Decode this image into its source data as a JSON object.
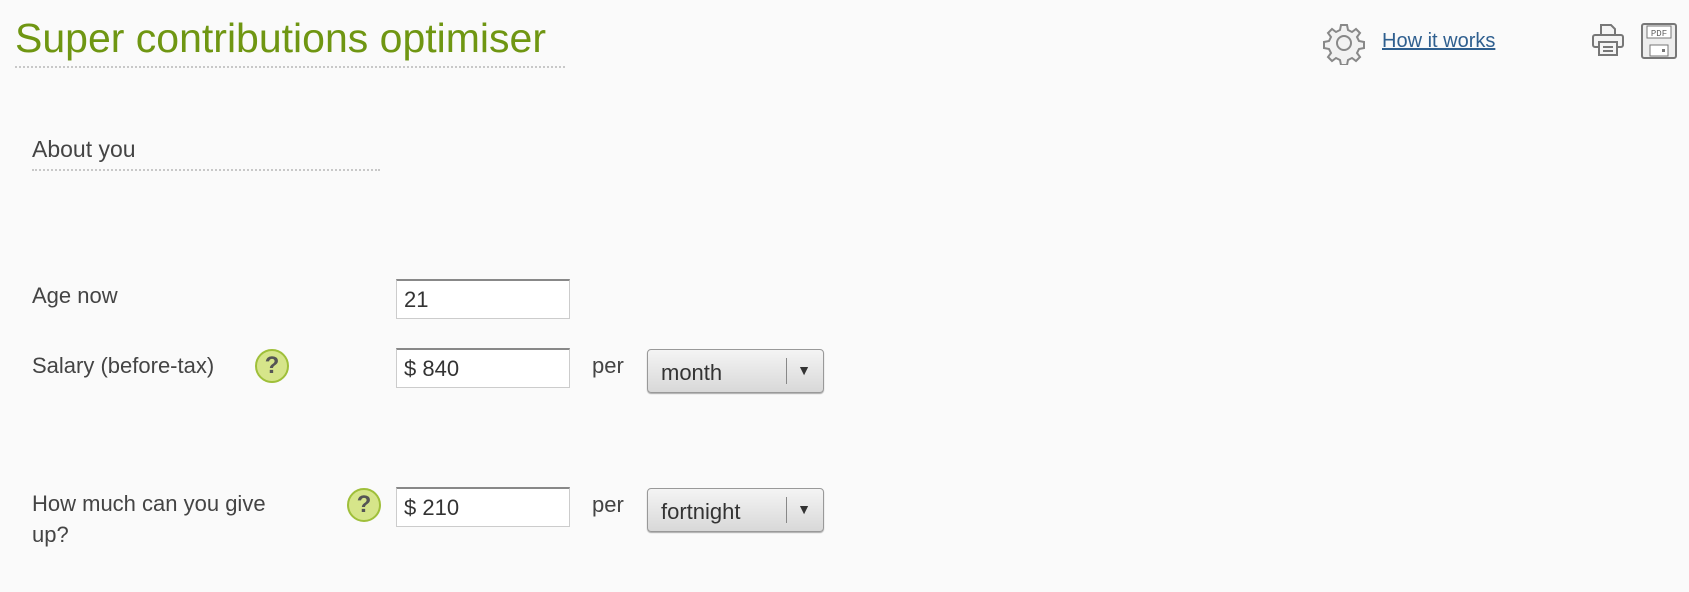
{
  "header": {
    "title": "Super contributions optimiser",
    "how_it_works": "How it works",
    "icons": [
      "gear-icon",
      "print-icon",
      "pdf-save-icon"
    ],
    "pdf_icon_text": "PDF"
  },
  "section": {
    "title": "About you"
  },
  "form": {
    "age": {
      "label": "Age now",
      "value": "21"
    },
    "salary": {
      "label": "Salary (before-tax)",
      "value": "$ 840",
      "per": "per",
      "period": "month",
      "help": "?"
    },
    "give_up": {
      "label": "How much can you give up?",
      "value": "$ 210",
      "per": "per",
      "period": "fortnight",
      "help": "?"
    }
  },
  "colors": {
    "title": "#6f9612",
    "link": "#2f5f8f",
    "help_fill": "#d6e58a"
  }
}
